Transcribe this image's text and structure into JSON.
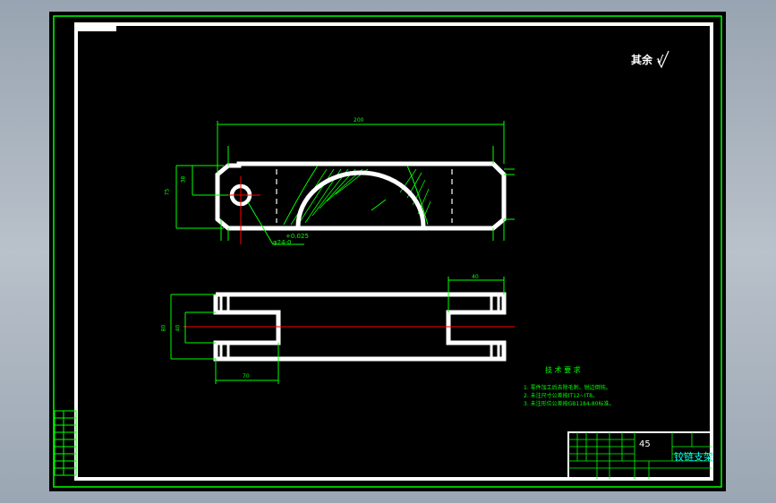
{
  "roughness_note": {
    "prefix": "其余",
    "symbol_value": "√"
  },
  "dimensions": {
    "top_overall_length": "200",
    "left_height_outer": "75",
    "left_height_inner": "38",
    "hole_tolerance": "+0.025",
    "hole_diameter": "φ24-0",
    "bottom_right_width": "40",
    "bottom_left_height": "80",
    "bottom_inner_height": "40",
    "bottom_lower_width": "70"
  },
  "tech_requirements": {
    "title": "技 术 要 求",
    "lines": [
      "1. 零件加工后去除毛刺、锐边倒钝。",
      "2. 未注尺寸公差按IT12~IT8。",
      "3. 未注形位公差按GB1184-80标准。"
    ]
  },
  "title_block": {
    "material": "45",
    "part_name": "铰链支架"
  },
  "colors": {
    "sheet": "#000000",
    "outline": "#ffffff",
    "dimension": "#00ff00",
    "centerline": "#ff0000"
  }
}
